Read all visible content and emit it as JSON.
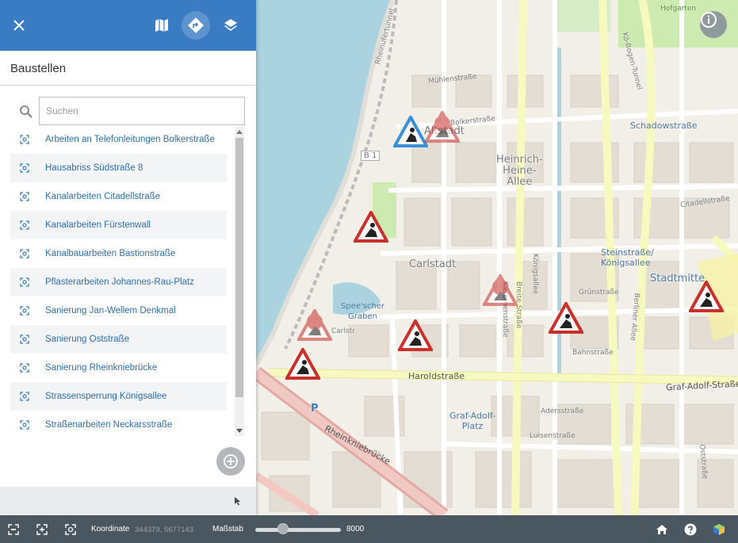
{
  "sidebar": {
    "title": "Baustellen",
    "search_placeholder": "Suchen",
    "items": [
      {
        "label": "Arbeiten an Telefonleitungen Bolkerstraße"
      },
      {
        "label": "Hausabriss Südstraße 8"
      },
      {
        "label": "Kanalarbeiten Citadellstraße"
      },
      {
        "label": "Kanalarbeiten Fürstenwall"
      },
      {
        "label": "Kanalbauarbeiten Bastionstraße"
      },
      {
        "label": "Pflasterarbeiten Johannes-Rau-Platz"
      },
      {
        "label": "Sanierung Jan-Wellem Denkmal"
      },
      {
        "label": "Sanierung Oststraße"
      },
      {
        "label": "Sanierung Rheinkniebrücke"
      },
      {
        "label": "Strassensperrung Königsallee"
      },
      {
        "label": "Straßenarbeiten Neckarsstraße"
      }
    ]
  },
  "header": {
    "close_icon": "close-icon",
    "map_icon": "map-icon",
    "directions_icon": "directions-icon",
    "layers_icon": "layers-icon"
  },
  "map": {
    "labels": {
      "hofgarten": "Hofgarten",
      "rheinufertunnel": "Rheinufertunnel",
      "muehlenstrasse": "Mühlenstraße",
      "bolkerstrasse": "Bolkerstraße",
      "altstadt": "Altstadt",
      "b1": "B 1",
      "heinrich_heine": "Heinrich-\nHeine-\nAllee",
      "carlstadt": "Carlstadt",
      "speescher": "Spee'scher\nGraben",
      "carlstr": "Carlstr",
      "haroldstrasse": "Haroldstraße",
      "rheinkniebruecke": "Rheinkniebrücke",
      "graf_adolf_platz": "Graf-Adolf-\nPlatz",
      "graf_adolf_strasse": "Graf-Adolf-Straße",
      "steinstrasse": "Steinstraße/\nKönigsallee",
      "stadtmitte": "Stadtmitte",
      "schadowstrasse": "Schadowstraße",
      "citadellstrasse": "Citadellstraße",
      "bahnstrasse": "Bahnstraße",
      "grunstrasse": "Grünstraße",
      "adersstrasse": "Adersstraße",
      "luisenstrasse": "Luisenstraße",
      "koenigsallee": "Königsallee",
      "kasernenstrasse": "Kasernenstraße",
      "breite_strasse": "Breite Straße",
      "berliner_allee": "Berliner Allee",
      "oststrasse": "Oststraße",
      "kobogentunnel": "Kö-Bogen-Tunnel",
      "p": "P"
    },
    "accent_marker_color": "#3a8fd6",
    "marker_color": "#c9302c"
  },
  "bottombar": {
    "coordinate_label": "Koordinate",
    "coordinate_value": "344379, 5677143",
    "scale_label": "Maßstab",
    "scale_value": "8000",
    "scale_slider_fraction": 0.32
  },
  "colors": {
    "header_blue": "#3a7cc4",
    "link_blue": "#2e6ea8",
    "bottombar": "#4a5660"
  }
}
